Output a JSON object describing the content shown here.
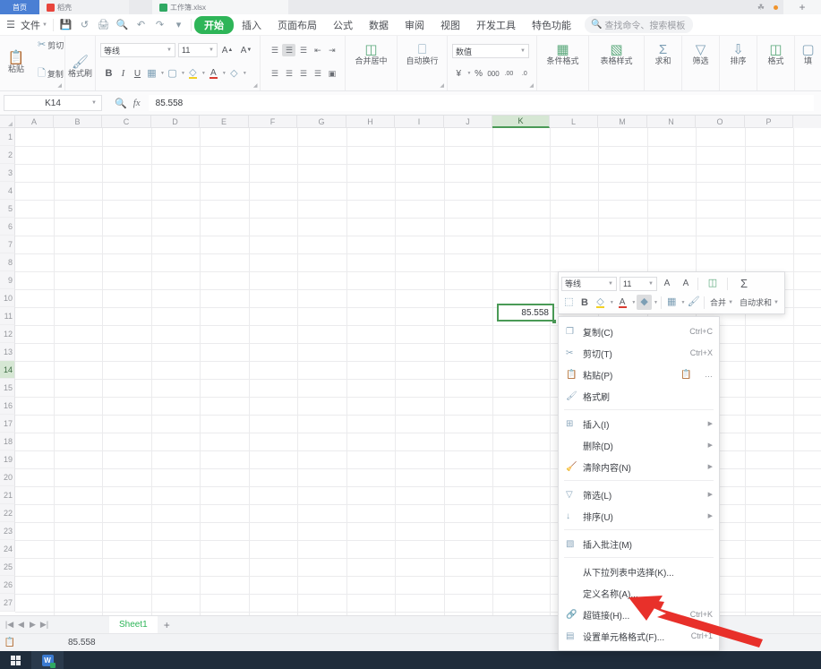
{
  "tabbar": {
    "home_tab": "首页",
    "docer_tab": "稻壳",
    "file_tab": "工作簿.xlsx",
    "new_tab": "+"
  },
  "menubar": {
    "file": "文件",
    "quick_icons": [
      "save-icon",
      "print-direct-icon",
      "print-icon",
      "print-preview-icon",
      "undo-icon",
      "redo-icon",
      "customize-icon"
    ],
    "items": [
      {
        "label": "开始",
        "active": true
      },
      {
        "label": "插入",
        "active": false
      },
      {
        "label": "页面布局",
        "active": false
      },
      {
        "label": "公式",
        "active": false
      },
      {
        "label": "数据",
        "active": false
      },
      {
        "label": "审阅",
        "active": false
      },
      {
        "label": "视图",
        "active": false
      },
      {
        "label": "开发工具",
        "active": false
      },
      {
        "label": "特色功能",
        "active": false
      }
    ],
    "search_placeholder": "查找命令、搜索模板"
  },
  "ribbon": {
    "clipboard": {
      "paste": "粘贴",
      "cut": "剪切",
      "copy": "复制",
      "format_painter": "格式刷"
    },
    "font": {
      "font_name": "等线",
      "font_size": "11",
      "grow_font": "A",
      "shrink_font": "A",
      "bold": "B",
      "italic": "I",
      "underline": "U",
      "borders": "田",
      "fill": "填充",
      "highlight": "突出显示",
      "font_color": "A",
      "clear_format": "清除格式"
    },
    "alignment": {
      "merge_center": "合并居中",
      "wrap_text": "自动换行"
    },
    "number": {
      "format": "数值",
      "currency": "¥",
      "percent": "%",
      "comma": "000",
      "inc_decimal": "增加小数位",
      "dec_decimal": "减少小数位"
    },
    "styles": {
      "conditional_format": "条件格式",
      "table_style": "表格样式"
    },
    "editing": {
      "sum": "求和",
      "filter": "筛选",
      "sort": "排序",
      "format": "格式",
      "fill": "填"
    }
  },
  "formulabar": {
    "name_box": "K14",
    "value": "85.558",
    "fx": "fx",
    "zoom_icon": "magnifier-icon"
  },
  "grid": {
    "columns": [
      "A",
      "B",
      "C",
      "D",
      "E",
      "F",
      "G",
      "H",
      "I",
      "J",
      "K",
      "L",
      "M",
      "N",
      "O",
      "P"
    ],
    "selected_column": "K",
    "rows": [
      "1",
      "2",
      "3",
      "4",
      "5",
      "6",
      "7",
      "8",
      "9",
      "10",
      "11",
      "12",
      "13",
      "14",
      "15",
      "16",
      "17",
      "18",
      "19",
      "20",
      "21",
      "22",
      "23",
      "24",
      "25",
      "26",
      "27"
    ],
    "selected_row": "14",
    "selected_cell": {
      "ref": "K14",
      "value": "85.558"
    }
  },
  "mini_toolbar": {
    "font_name": "等线",
    "font_size": "11",
    "grow_font": "A",
    "shrink_font": "A",
    "merge": "合并",
    "autosum": "自动求和",
    "bold": "B",
    "buttons": [
      "format-painter-icon",
      "bold-icon",
      "highlight-color-icon",
      "font-color-icon",
      "fill-color-icon",
      "borders-icon",
      "format-brush-icon"
    ]
  },
  "context_menu": {
    "items": [
      {
        "icon": "copy-icon",
        "label": "复制(C)",
        "shortcut": "Ctrl+C",
        "arrow": false,
        "sep_after": false
      },
      {
        "icon": "cut-icon",
        "label": "剪切(T)",
        "shortcut": "Ctrl+X",
        "arrow": false,
        "sep_after": false
      },
      {
        "icon": "paste-icon",
        "label": "粘贴(P)",
        "shortcut": "",
        "arrow": false,
        "sep_after": false,
        "extra": true
      },
      {
        "icon": "format-painter-icon",
        "label": "格式刷",
        "shortcut": "",
        "arrow": false,
        "sep_after": true
      },
      {
        "icon": "insert-icon",
        "label": "插入(I)",
        "shortcut": "",
        "arrow": true,
        "sep_after": false
      },
      {
        "icon": "none",
        "label": "删除(D)",
        "shortcut": "",
        "arrow": true,
        "sep_after": false
      },
      {
        "icon": "clear-icon",
        "label": "清除内容(N)",
        "shortcut": "",
        "arrow": true,
        "sep_after": true
      },
      {
        "icon": "filter-icon",
        "label": "筛选(L)",
        "shortcut": "",
        "arrow": true,
        "sep_after": false
      },
      {
        "icon": "sort-icon",
        "label": "排序(U)",
        "shortcut": "",
        "arrow": true,
        "sep_after": true
      },
      {
        "icon": "comment-icon",
        "label": "插入批注(M)",
        "shortcut": "",
        "arrow": false,
        "sep_after": true
      },
      {
        "icon": "none",
        "label": "从下拉列表中选择(K)...",
        "shortcut": "",
        "arrow": false,
        "sep_after": false
      },
      {
        "icon": "none",
        "label": "定义名称(A)...",
        "shortcut": "",
        "arrow": false,
        "sep_after": false
      },
      {
        "icon": "link-icon",
        "label": "超链接(H)...",
        "shortcut": "Ctrl+K",
        "arrow": false,
        "sep_after": false
      },
      {
        "icon": "cell-format-icon",
        "label": "设置单元格格式(F)...",
        "shortcut": "Ctrl+1",
        "arrow": false,
        "sep_after": false
      }
    ],
    "paste_extra_icon": "paste-special-icon",
    "paste_more": "…"
  },
  "annotation": {
    "arrow_color": "#e8302a",
    "points_to": "设置单元格格式(F)..."
  },
  "sheetbar": {
    "sheet_name": "Sheet1",
    "add_sheet": "+"
  },
  "statusbar": {
    "value": "85.558"
  },
  "taskbar": {
    "apps": [
      "windows-start-icon",
      "wps-office-icon"
    ]
  },
  "colors": {
    "accent_green": "#2eb558",
    "selection_green": "#4a9a56",
    "tab_blue": "#4a7fd4",
    "arrow_red": "#e8302a",
    "taskbar": "#1f2c3b"
  }
}
